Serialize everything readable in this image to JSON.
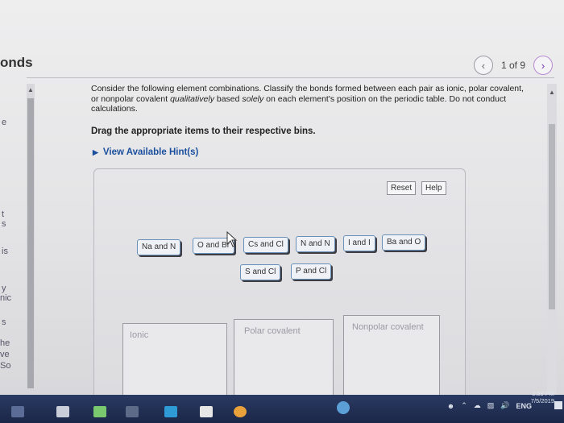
{
  "header": {
    "title_fragment": "onds",
    "pager": {
      "count": "1 of 9",
      "prev_icon": "chevron-left-icon",
      "next_icon": "chevron-right-icon"
    }
  },
  "left_strip": {
    "fragments": [
      "e",
      "t",
      "s",
      "is",
      "y",
      "nic",
      "s",
      "he",
      "ve",
      "So"
    ]
  },
  "question": {
    "text_pre": "Consider the following element combinations. Classify the bonds formed between each pair as ionic, polar covalent, or nonpolar covalent ",
    "emph1": "qualitatively",
    "text_mid": " based ",
    "emph2": "solely",
    "text_post": " on each element's position on the periodic table. Do not conduct calculations.",
    "instruction": "Drag the appropriate items to their respective bins.",
    "hint_label": "View Available Hint(s)"
  },
  "toolbar": {
    "reset_label": "Reset",
    "help_label": "Help"
  },
  "chips": [
    {
      "label": "Na and N"
    },
    {
      "label": "O and Br"
    },
    {
      "label": "Cs and Cl"
    },
    {
      "label": "N and N"
    },
    {
      "label": "I and I"
    },
    {
      "label": "Ba and O"
    },
    {
      "label": "S and Cl"
    },
    {
      "label": "P and Cl"
    }
  ],
  "bins": [
    {
      "label": "Ionic"
    },
    {
      "label": "Polar covalent"
    },
    {
      "label": "Nonpolar covalent"
    }
  ],
  "taskbar": {
    "language": "ENG",
    "time": "3:58 PM",
    "date": "7/5/2019"
  },
  "colors": {
    "accent": "#1a4f9e",
    "chip_border": "#6a8fb8",
    "taskbar": "#1b2748"
  }
}
